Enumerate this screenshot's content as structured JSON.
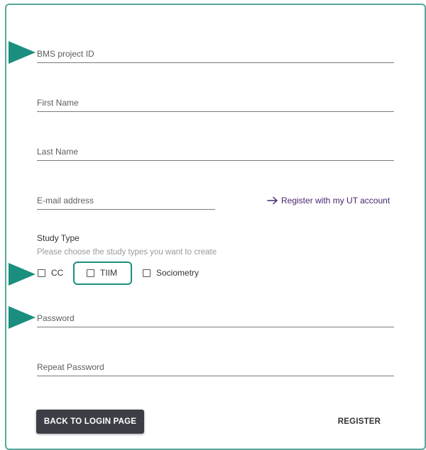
{
  "form": {
    "project_id_placeholder": "BMS project ID",
    "first_name_placeholder": "First Name",
    "last_name_placeholder": "Last Name",
    "email_placeholder": "E-mail address",
    "password_placeholder": "Password",
    "repeat_password_placeholder": "Repeat Password"
  },
  "ut_link": {
    "label": "Register with my UT account",
    "icon": "arrow-right-icon"
  },
  "study_type": {
    "title": "Study Type",
    "hint": "Please choose the study types you want to create",
    "options": [
      {
        "label": "CC",
        "checked": false
      },
      {
        "label": "TIIM",
        "checked": false
      },
      {
        "label": "Sociometry",
        "checked": false
      }
    ]
  },
  "buttons": {
    "back_label": "BACK TO LOGIN PAGE",
    "register_label": "REGISTER"
  },
  "colors": {
    "frame": "#55a79a",
    "annotation_arrow": "#1b8f7f",
    "link": "#4a2470",
    "primary_button": "#3b3f45"
  }
}
